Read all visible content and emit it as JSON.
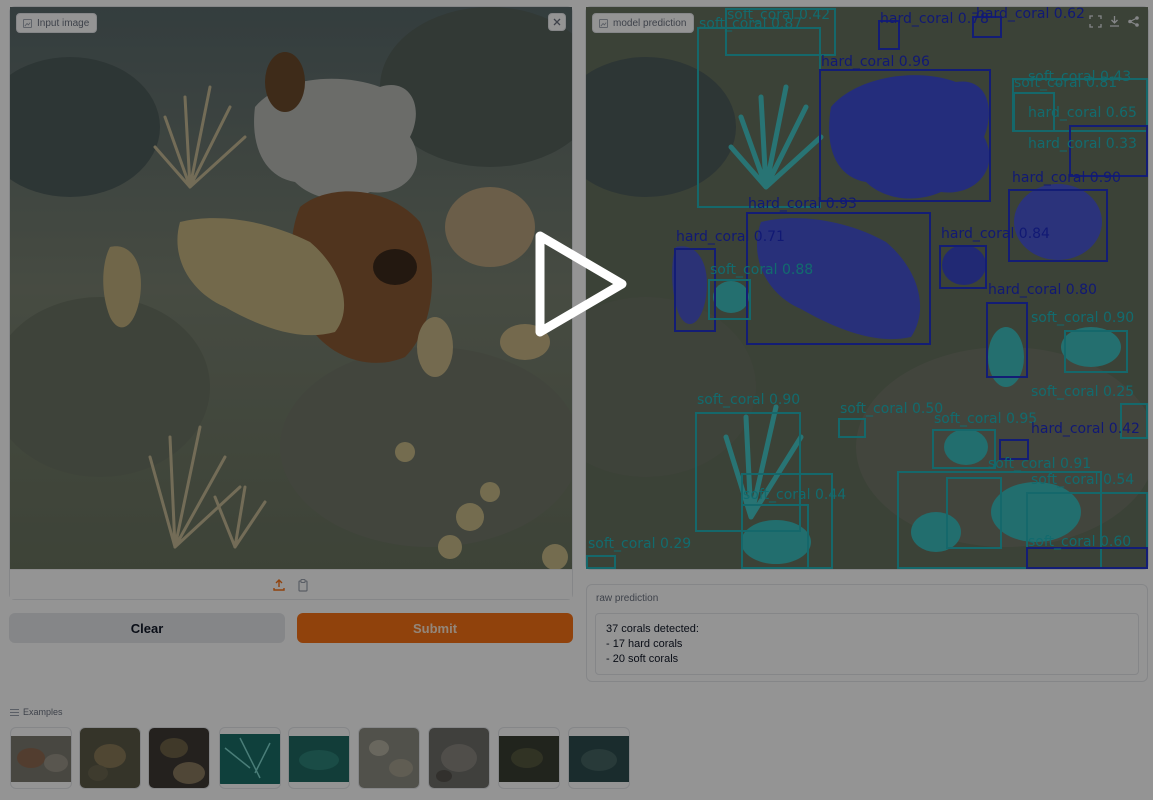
{
  "input_panel": {
    "label": "Input image"
  },
  "prediction_panel": {
    "label": "model prediction"
  },
  "buttons": {
    "clear": "Clear",
    "submit": "Submit"
  },
  "raw": {
    "title": "raw prediction",
    "line1": "37 corals detected:",
    "line2": "- 17 hard corals",
    "line3": "- 20 soft corals"
  },
  "examples": {
    "title": "Examples"
  },
  "detections": {
    "d1": "soft_coral 0.42",
    "d2": "soft_coral 0.87",
    "d3": "hard_coral 0.78",
    "d4": "hard_coral 0.62",
    "d5": "hard_coral 0.96",
    "d6": "soft_coral 0.43",
    "d7": "soft_coral 0.81",
    "d8": "hard_coral 0.65",
    "d9": "hard_coral 0.33",
    "d10": "hard_coral 0.90",
    "d11": "hard_coral 0.93",
    "d12": "hard_coral 0.71",
    "d13": "hard_coral 0.84",
    "d14": "soft_coral 0.88",
    "d15": "hard_coral 0.80",
    "d16": "soft_coral 0.90",
    "d17": "soft_coral 0.25",
    "d18": "soft_coral 0.90",
    "d19": "soft_coral 0.50",
    "d20": "soft_coral 0.95",
    "d21": "hard_coral 0.42",
    "d22": "soft_coral 0.91",
    "d23": "soft_coral 0.54",
    "d24": "soft_coral 0.44",
    "d25": "soft_coral 0.29",
    "d26": "soft_coral 0.60"
  },
  "colors": {
    "hard_coral": "#2233cc",
    "soft_coral": "#25b3b8",
    "submit": "#f97316",
    "clear": "#e5e7eb"
  },
  "icons": [
    "image-icon",
    "close-icon",
    "upload-icon",
    "clipboard-icon",
    "fullscreen-icon",
    "download-icon",
    "share-icon",
    "list-icon",
    "play-icon"
  ]
}
